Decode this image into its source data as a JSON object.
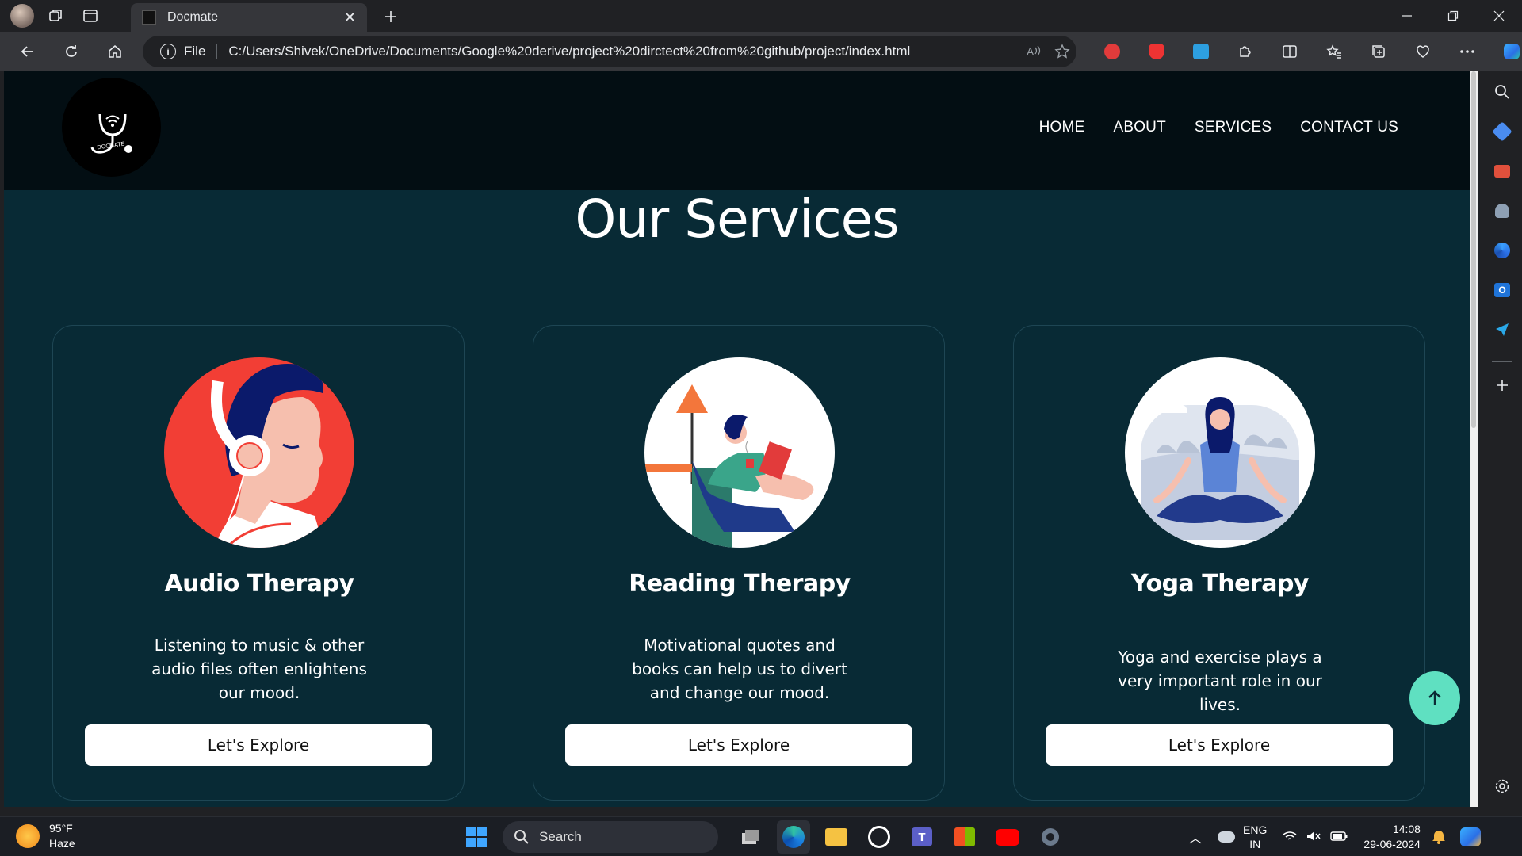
{
  "browser": {
    "tab_title": "Docmate",
    "address_label": "File",
    "url": "C:/Users/Shivek/OneDrive/Documents/Google%20derive/project%20dirctect%20from%20github/project/index.html"
  },
  "site": {
    "logo_text": "DOCMATE",
    "nav": [
      "HOME",
      "ABOUT",
      "SERVICES",
      "CONTACT US"
    ],
    "section_title": "Our Services",
    "cards": [
      {
        "title": "Audio Therapy",
        "desc_lines": [
          "Listening to music & other",
          "audio files often enlightens",
          "our mood."
        ],
        "button": "Let's Explore",
        "illustration": "headphones-person"
      },
      {
        "title": "Reading Therapy",
        "desc_lines": [
          "Motivational quotes and",
          "books can help us to divert",
          "and change our mood."
        ],
        "button": "Let's Explore",
        "illustration": "reading-woman"
      },
      {
        "title": "Yoga Therapy",
        "desc_lines": [
          "Yoga and exercise plays a",
          "very important role in our lives."
        ],
        "button": "Let's Explore",
        "illustration": "meditating-woman"
      }
    ]
  },
  "taskbar": {
    "temperature": "95°F",
    "weather": "Haze",
    "search_placeholder": "Search",
    "lang_top": "ENG",
    "lang_bottom": "IN",
    "time": "14:08",
    "date": "29-06-2024"
  },
  "colors": {
    "page_bg": "#082a35",
    "header_bg": "#030e13",
    "scroll_top_button": "#5fe0c1"
  }
}
